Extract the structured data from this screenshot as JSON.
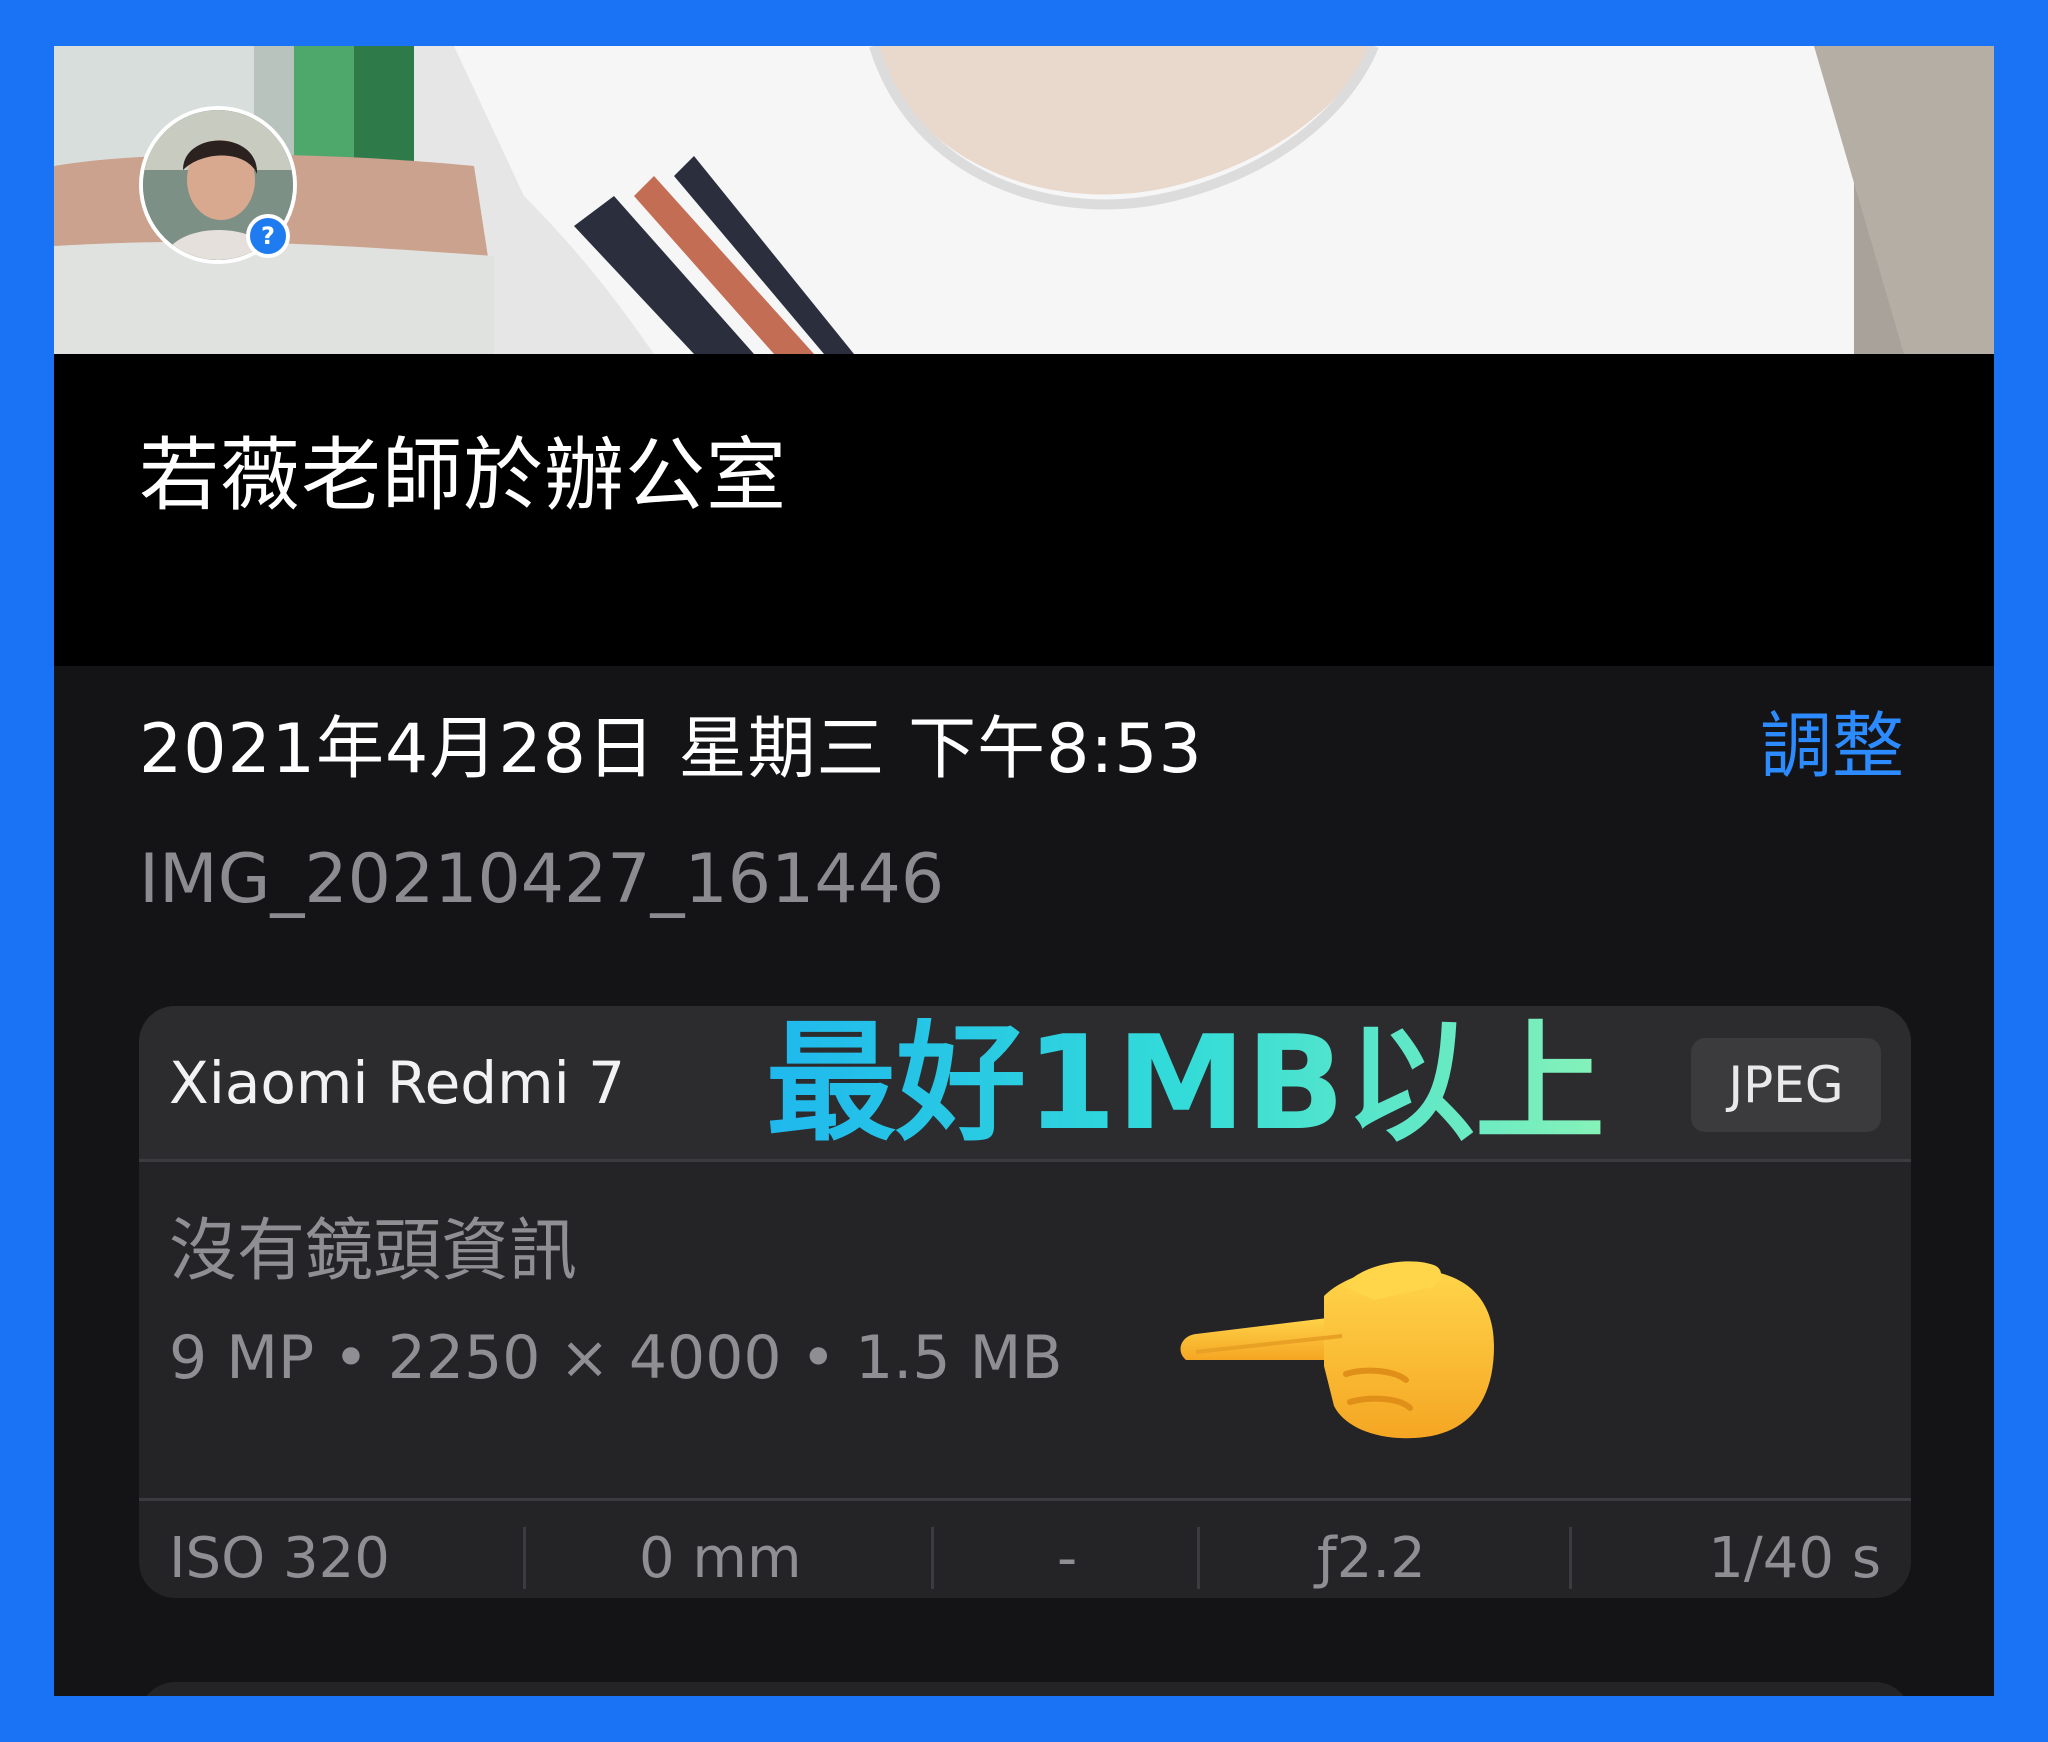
{
  "photo": {
    "caption": "若薇老師於辦公室",
    "avatar_badge": "?"
  },
  "details": {
    "datetime": "2021年4月28日 星期三 下午8:53",
    "adjust_label": "調整",
    "filename": "IMG_20210427_161446"
  },
  "camera": {
    "device": "Xiaomi Redmi 7",
    "format": "JPEG",
    "lens": "沒有鏡頭資訊",
    "specs": "9 MP • 2250 × 4000 • 1.5 MB",
    "exif": {
      "iso": "ISO 320",
      "focal_length": "0 mm",
      "exposure_bias": "-",
      "aperture": "ƒ2.2",
      "shutter": "1/40 s"
    }
  },
  "annotation": {
    "text": "最好1MB以上",
    "icon": "pointing-hand-icon"
  },
  "colors": {
    "frame": "#1a73f5",
    "accent": "#2b8bff",
    "card": "#242427"
  }
}
